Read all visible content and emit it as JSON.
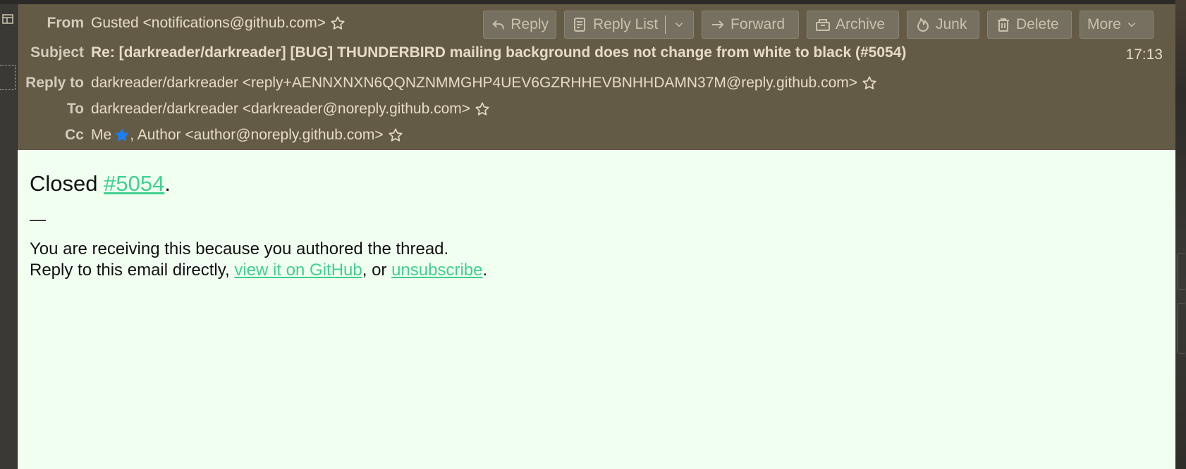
{
  "header": {
    "from_label": "From",
    "from_value": "Gusted <notifications@github.com>",
    "subject_label": "Subject",
    "subject_value": "Re: [darkreader/darkreader] [BUG] THUNDERBIRD mailing background does not change from white to black (#5054)",
    "time": "17:13",
    "replyto_label": "Reply to",
    "replyto_value": "darkreader/darkreader <reply+AENNXNXN6QQNZNMMGHP4UEV6GZRHHEVBNHHDAMN37M@reply.github.com>",
    "to_label": "To",
    "to_value": "darkreader/darkreader <darkreader@noreply.github.com>",
    "cc_label": "Cc",
    "cc_me": "Me",
    "cc_rest": ", Author <author@noreply.github.com>"
  },
  "toolbar": {
    "reply": "Reply",
    "reply_list": "Reply List",
    "forward": "Forward",
    "archive": "Archive",
    "junk": "Junk",
    "delete": "Delete",
    "more": "More"
  },
  "body": {
    "closed_prefix": "Closed ",
    "closed_link": "#5054",
    "closed_suffix": ".",
    "dash": "—",
    "line1": "You are receiving this because you authored the thread.",
    "line2_prefix": "Reply to this email directly, ",
    "line2_link1": "view it on GitHub",
    "line2_mid": ", or ",
    "line2_link2": "unsubscribe",
    "line2_suffix": "."
  },
  "colors": {
    "header_bg": "#645b47",
    "body_bg": "#f1fff1",
    "link": "#3fd190",
    "star_blue": "#1a7fff"
  }
}
